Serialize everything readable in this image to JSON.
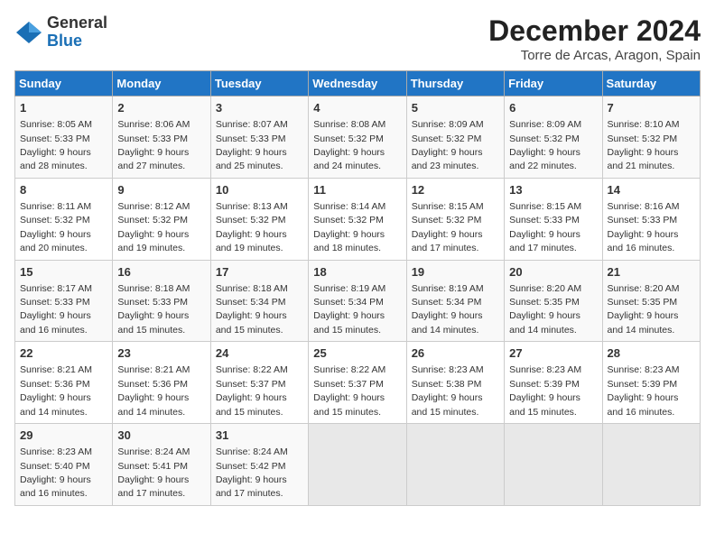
{
  "header": {
    "logo_general": "General",
    "logo_blue": "Blue",
    "month_title": "December 2024",
    "location": "Torre de Arcas, Aragon, Spain"
  },
  "weekdays": [
    "Sunday",
    "Monday",
    "Tuesday",
    "Wednesday",
    "Thursday",
    "Friday",
    "Saturday"
  ],
  "weeks": [
    [
      {
        "day": "1",
        "sunrise": "8:05 AM",
        "sunset": "5:33 PM",
        "daylight": "9 hours and 28 minutes."
      },
      {
        "day": "2",
        "sunrise": "8:06 AM",
        "sunset": "5:33 PM",
        "daylight": "9 hours and 27 minutes."
      },
      {
        "day": "3",
        "sunrise": "8:07 AM",
        "sunset": "5:33 PM",
        "daylight": "9 hours and 25 minutes."
      },
      {
        "day": "4",
        "sunrise": "8:08 AM",
        "sunset": "5:32 PM",
        "daylight": "9 hours and 24 minutes."
      },
      {
        "day": "5",
        "sunrise": "8:09 AM",
        "sunset": "5:32 PM",
        "daylight": "9 hours and 23 minutes."
      },
      {
        "day": "6",
        "sunrise": "8:09 AM",
        "sunset": "5:32 PM",
        "daylight": "9 hours and 22 minutes."
      },
      {
        "day": "7",
        "sunrise": "8:10 AM",
        "sunset": "5:32 PM",
        "daylight": "9 hours and 21 minutes."
      }
    ],
    [
      {
        "day": "8",
        "sunrise": "8:11 AM",
        "sunset": "5:32 PM",
        "daylight": "9 hours and 20 minutes."
      },
      {
        "day": "9",
        "sunrise": "8:12 AM",
        "sunset": "5:32 PM",
        "daylight": "9 hours and 19 minutes."
      },
      {
        "day": "10",
        "sunrise": "8:13 AM",
        "sunset": "5:32 PM",
        "daylight": "9 hours and 19 minutes."
      },
      {
        "day": "11",
        "sunrise": "8:14 AM",
        "sunset": "5:32 PM",
        "daylight": "9 hours and 18 minutes."
      },
      {
        "day": "12",
        "sunrise": "8:15 AM",
        "sunset": "5:32 PM",
        "daylight": "9 hours and 17 minutes."
      },
      {
        "day": "13",
        "sunrise": "8:15 AM",
        "sunset": "5:33 PM",
        "daylight": "9 hours and 17 minutes."
      },
      {
        "day": "14",
        "sunrise": "8:16 AM",
        "sunset": "5:33 PM",
        "daylight": "9 hours and 16 minutes."
      }
    ],
    [
      {
        "day": "15",
        "sunrise": "8:17 AM",
        "sunset": "5:33 PM",
        "daylight": "9 hours and 16 minutes."
      },
      {
        "day": "16",
        "sunrise": "8:18 AM",
        "sunset": "5:33 PM",
        "daylight": "9 hours and 15 minutes."
      },
      {
        "day": "17",
        "sunrise": "8:18 AM",
        "sunset": "5:34 PM",
        "daylight": "9 hours and 15 minutes."
      },
      {
        "day": "18",
        "sunrise": "8:19 AM",
        "sunset": "5:34 PM",
        "daylight": "9 hours and 15 minutes."
      },
      {
        "day": "19",
        "sunrise": "8:19 AM",
        "sunset": "5:34 PM",
        "daylight": "9 hours and 14 minutes."
      },
      {
        "day": "20",
        "sunrise": "8:20 AM",
        "sunset": "5:35 PM",
        "daylight": "9 hours and 14 minutes."
      },
      {
        "day": "21",
        "sunrise": "8:20 AM",
        "sunset": "5:35 PM",
        "daylight": "9 hours and 14 minutes."
      }
    ],
    [
      {
        "day": "22",
        "sunrise": "8:21 AM",
        "sunset": "5:36 PM",
        "daylight": "9 hours and 14 minutes."
      },
      {
        "day": "23",
        "sunrise": "8:21 AM",
        "sunset": "5:36 PM",
        "daylight": "9 hours and 14 minutes."
      },
      {
        "day": "24",
        "sunrise": "8:22 AM",
        "sunset": "5:37 PM",
        "daylight": "9 hours and 15 minutes."
      },
      {
        "day": "25",
        "sunrise": "8:22 AM",
        "sunset": "5:37 PM",
        "daylight": "9 hours and 15 minutes."
      },
      {
        "day": "26",
        "sunrise": "8:23 AM",
        "sunset": "5:38 PM",
        "daylight": "9 hours and 15 minutes."
      },
      {
        "day": "27",
        "sunrise": "8:23 AM",
        "sunset": "5:39 PM",
        "daylight": "9 hours and 15 minutes."
      },
      {
        "day": "28",
        "sunrise": "8:23 AM",
        "sunset": "5:39 PM",
        "daylight": "9 hours and 16 minutes."
      }
    ],
    [
      {
        "day": "29",
        "sunrise": "8:23 AM",
        "sunset": "5:40 PM",
        "daylight": "9 hours and 16 minutes."
      },
      {
        "day": "30",
        "sunrise": "8:24 AM",
        "sunset": "5:41 PM",
        "daylight": "9 hours and 17 minutes."
      },
      {
        "day": "31",
        "sunrise": "8:24 AM",
        "sunset": "5:42 PM",
        "daylight": "9 hours and 17 minutes."
      },
      null,
      null,
      null,
      null
    ]
  ],
  "labels": {
    "sunrise": "Sunrise:",
    "sunset": "Sunset:",
    "daylight": "Daylight:"
  }
}
